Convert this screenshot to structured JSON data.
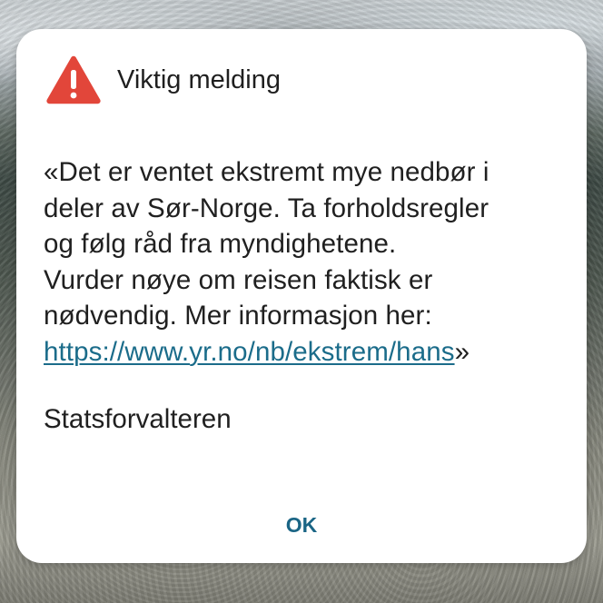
{
  "dialog": {
    "title": "Viktig melding",
    "icon": "warning-triangle-icon",
    "icon_color": "#e2463a",
    "message": {
      "lines": [
        "«Det er ventet ekstremt mye nedbør i",
        "deler av Sør-Norge. Ta forholdsregler",
        "og følg råd fra myndighetene.",
        "Vurder nøye om reisen faktisk er",
        "nødvendig. Mer informasjon her:"
      ],
      "link_text": "https://www.yr.no/nb/ekstrem/hans",
      "closing_quote": "»"
    },
    "signature": "Statsforvalteren",
    "ok_label": "OK",
    "accent_color": "#1a6585"
  }
}
